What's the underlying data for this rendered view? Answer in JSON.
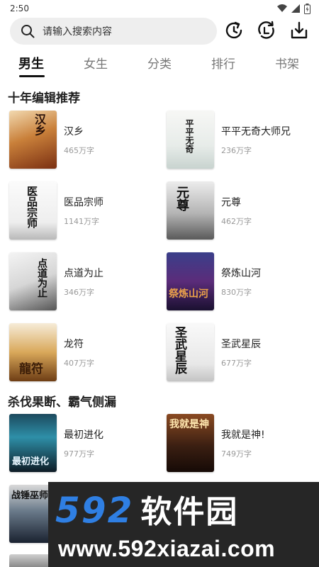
{
  "status": {
    "time": "2:50"
  },
  "search": {
    "placeholder": "请输入搜索内容"
  },
  "tabs": [
    {
      "label": "男生",
      "active": true
    },
    {
      "label": "女生",
      "active": false
    },
    {
      "label": "分类",
      "active": false
    },
    {
      "label": "排行",
      "active": false
    },
    {
      "label": "书架",
      "active": false
    }
  ],
  "sections": [
    {
      "title": "十年编辑推荐",
      "books": [
        {
          "title": "汉乡",
          "words": "465万字",
          "cover_text": "汉乡"
        },
        {
          "title": "平平无奇大师兄",
          "words": "236万字",
          "cover_text": "平平无奇"
        },
        {
          "title": "医品宗师",
          "words": "1141万字",
          "cover_text": "医品宗师"
        },
        {
          "title": "元尊",
          "words": "462万字",
          "cover_text": "元尊"
        },
        {
          "title": "点道为止",
          "words": "346万字",
          "cover_text": "点道为止"
        },
        {
          "title": "祭炼山河",
          "words": "830万字",
          "cover_text": "祭炼山河"
        },
        {
          "title": "龙符",
          "words": "407万字",
          "cover_text": "龍符"
        },
        {
          "title": "圣武星辰",
          "words": "677万字",
          "cover_text": "圣武星辰"
        }
      ]
    },
    {
      "title": "杀伐果断、霸气侧漏",
      "books": [
        {
          "title": "最初进化",
          "words": "977万字",
          "cover_text": "最初进化"
        },
        {
          "title": "我就是神!",
          "words": "749万字",
          "cover_text": "我就是神"
        }
      ]
    }
  ],
  "partial_cover": {
    "cover_text": "战锤巫师"
  },
  "watermark": {
    "logo_num": "592",
    "logo_cn": "软件园",
    "url": "www.592xiazai.com"
  },
  "colors": {
    "accent": "#2f7fe3",
    "watermark_bg": "#262626"
  }
}
